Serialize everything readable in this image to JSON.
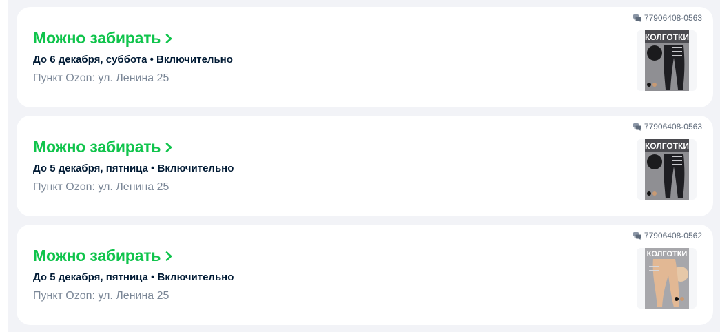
{
  "orders": [
    {
      "status": "Можно забирать",
      "date": "До 6 декабря, суббота • Включительно",
      "pickup": "Пункт Ozon: ул. Ленина 25",
      "order_number": "77906408-0563",
      "product_label": "КОЛГОТКИ",
      "product_variant": "black"
    },
    {
      "status": "Можно забирать",
      "date": "До 5 декабря, пятница • Включительно",
      "pickup": "Пункт Ozon: ул. Ленина 25",
      "order_number": "77906408-0563",
      "product_label": "КОЛГОТКИ",
      "product_variant": "black"
    },
    {
      "status": "Можно забирать",
      "date": "До 5 декабря, пятница • Включительно",
      "pickup": "Пункт Ozon: ул. Ленина 25",
      "order_number": "77906408-0562",
      "product_label": "КОЛГОТКИ",
      "product_variant": "beige"
    }
  ],
  "colors": {
    "status_green": "#10c44c",
    "text_dark": "#001a34",
    "text_muted": "#7b8797",
    "background": "#f2f3f7"
  },
  "icons": {
    "status_arrow": "chevron-right-icon",
    "order_number": "chat-bubbles-icon"
  }
}
